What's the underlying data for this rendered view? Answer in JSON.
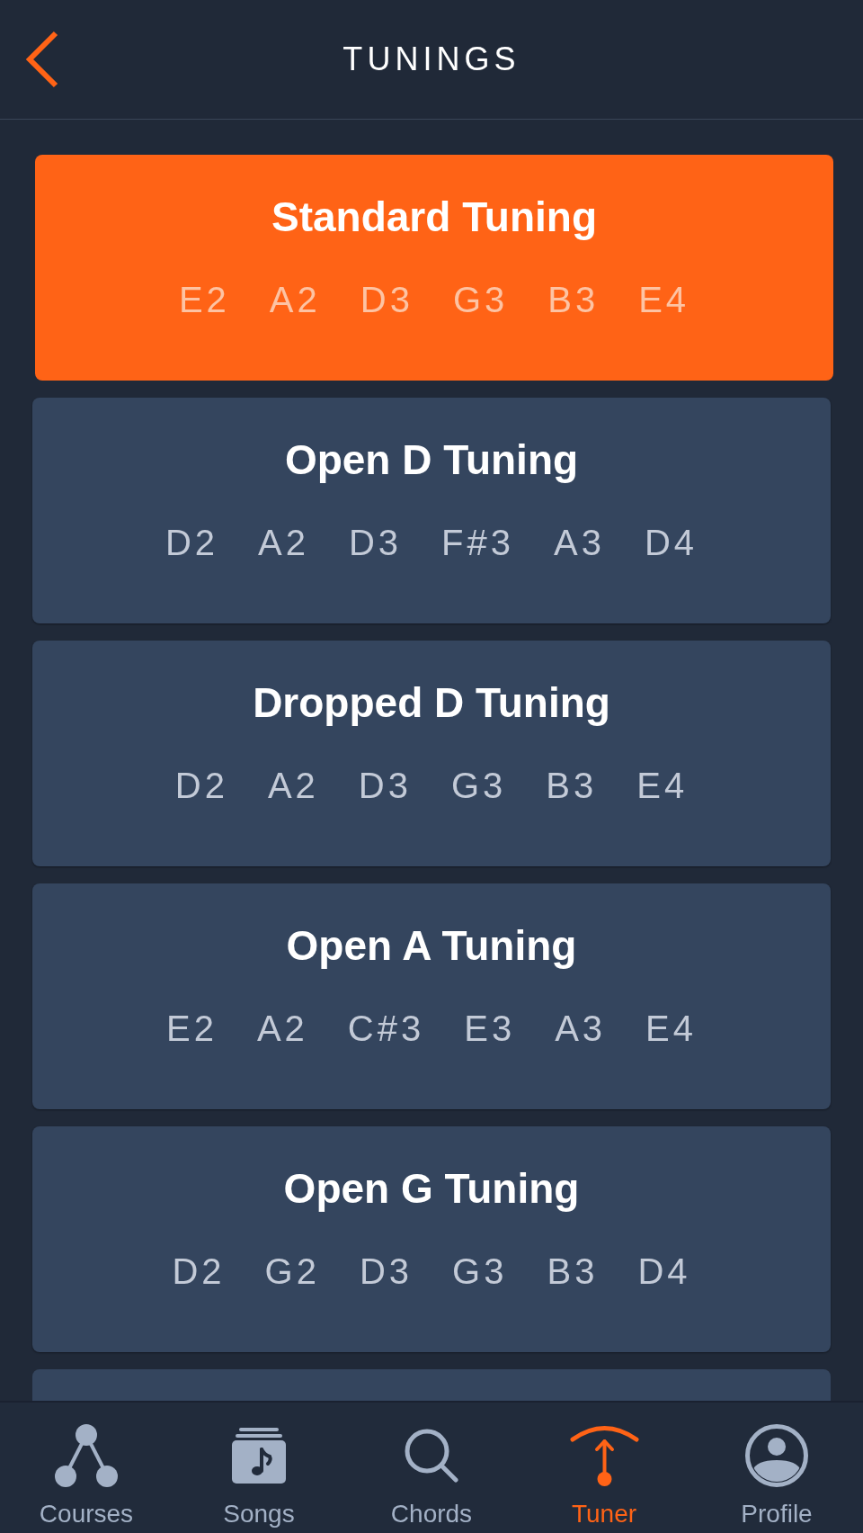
{
  "header": {
    "title": "TUNINGS"
  },
  "tunings": [
    {
      "name": "Standard Tuning",
      "notes": [
        "E2",
        "A2",
        "D3",
        "G3",
        "B3",
        "E4"
      ],
      "selected": true
    },
    {
      "name": "Open D Tuning",
      "notes": [
        "D2",
        "A2",
        "D3",
        "F#3",
        "A3",
        "D4"
      ],
      "selected": false
    },
    {
      "name": "Dropped D Tuning",
      "notes": [
        "D2",
        "A2",
        "D3",
        "G3",
        "B3",
        "E4"
      ],
      "selected": false
    },
    {
      "name": "Open A Tuning",
      "notes": [
        "E2",
        "A2",
        "C#3",
        "E3",
        "A3",
        "E4"
      ],
      "selected": false
    },
    {
      "name": "Open G Tuning",
      "notes": [
        "D2",
        "G2",
        "D3",
        "G3",
        "B3",
        "D4"
      ],
      "selected": false
    }
  ],
  "tabs": [
    {
      "label": "Courses",
      "selected": false
    },
    {
      "label": "Songs",
      "selected": false
    },
    {
      "label": "Chords",
      "selected": false
    },
    {
      "label": "Tuner",
      "selected": true
    },
    {
      "label": "Profile",
      "selected": false
    }
  ]
}
